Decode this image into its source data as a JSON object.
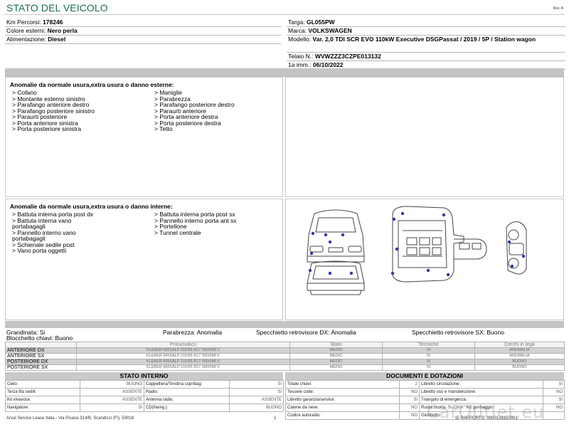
{
  "header": {
    "title": "STATO DEL VEICOLO",
    "rev": "Rev. A"
  },
  "info_left": [
    {
      "label": "Km Percorsi:",
      "value": "178246"
    },
    {
      "label": "Colore esterni:",
      "value": "Nero perla"
    },
    {
      "label": "Alimentazione:",
      "value": "Diesel"
    }
  ],
  "info_right": {
    "targa_label": "Targa:",
    "targa": "GL055PW",
    "marca_label": "Marca:",
    "marca": "VOLKSWAGEN",
    "modello_label": "Modello:",
    "modello": "Var. 2,0 TDI SCR EVO 110kW Executive DSGPassat / 2019 / 5P / Station wagon",
    "telaio_label": "Telaio N.:",
    "telaio": "WVWZZZ3CZPE013132",
    "imm_label": "1a imm.:",
    "imm": "06/10/2022"
  },
  "external_damage": {
    "title": "Anomalie da normale usura,extra usura o danno esterne:",
    "col1": [
      "> Cofano",
      "> Montante esterno sinistro",
      "> Parafango anteriore destro",
      "> Parafango posteriore sinistro",
      "> Paraurti posteriore",
      "> Porta anteriore sinistra",
      "> Porta posteriore sinistra"
    ],
    "col2": [
      "> Maniglie",
      "> Parabrezza",
      "> Parafango posteriore destro",
      "> Paraurti anteriore",
      "> Porta anteriore destra",
      "> Porta posteriore destra",
      "> Tetto"
    ]
  },
  "internal_damage": {
    "title": "Anomalie da normale usura,extra usura o danno interne:",
    "col1": [
      "> Battuta interna porta post dx",
      "> Battuta interna vano",
      "portabagagli",
      "> Pannello interno vano",
      "portabagagli",
      "> Schienale sedile post",
      "> Vano porta oggetti"
    ],
    "col2": [
      "> Battuta interna porta post sx",
      "> Pannello interno porta ant sx",
      "> Portellone",
      "> Tunnel centrale"
    ]
  },
  "status_line": {
    "grandinata": "Grandinata: Si",
    "chiavi": "Blocchetto chiavi: Buono",
    "parabrezza": "Parabrezza: Anomalia",
    "specchio_dx": "Specchietto retrovisore DX: Anomalia",
    "specchio_sx": "Specchietto retrovisore SX: Buono"
  },
  "tyres": {
    "headers": [
      "",
      "Pneumatico",
      "Stato",
      "Termiche",
      "Cerchi in lega"
    ],
    "rows": [
      {
        "pos": "ANTERIORE DX",
        "tyre": "KLEBER KRISALP 215/55 R17 000/098 V",
        "stato": "MEDIO",
        "termiche": "SI",
        "cerchi": "ANOMALIA"
      },
      {
        "pos": "ANTERIORE SX",
        "tyre": "KLEBER KRISALP 215/55 R17 000/098 V",
        "stato": "MEDIO",
        "termiche": "SI",
        "cerchi": "ANOMALIA"
      },
      {
        "pos": "POSTERIORE DX",
        "tyre": "KLEBER KRISALP 215/55 R17 000/098 V",
        "stato": "MEDIO",
        "termiche": "SI",
        "cerchi": "BUONO"
      },
      {
        "pos": "POSTERIORE SX",
        "tyre": "KLEBER KRISALP 215/55 R17 000/098 V",
        "stato": "MEDIO",
        "termiche": "SI",
        "cerchi": "BUONO"
      }
    ]
  },
  "stato_interno": {
    "title": "STATO INTERNO",
    "rows": [
      [
        "Cielo:",
        "BUONO",
        "Cappelliera/Tendina copribag:",
        "SI"
      ],
      [
        "Terza fila sedili:",
        "ASSENTE",
        "Radio:",
        "SI"
      ],
      [
        "Kit vivavoce:",
        "ASSENTE",
        "Antenna radio:",
        "ASSENTE"
      ],
      [
        "Navigatore:",
        "SI",
        "CD(Navig.):",
        "BUONO"
      ]
    ]
  },
  "documenti": {
    "title": "DOCUMENTI E DOTAZIONI",
    "rows": [
      [
        "Totale chiavi:",
        "2",
        "Libretto circolazione:",
        "SI"
      ],
      [
        "Tessere code:",
        "NO",
        "Libretto uso e manutenzione:",
        "NO"
      ],
      [
        "Libretto garanzia/service:",
        "SI",
        "Triangolo di emergenza:",
        "SI"
      ],
      [
        "Catene da neve:",
        "NO",
        "Ruota scorta:",
        "SUONA",
        "Kit gonfiaggio:",
        "NO"
      ],
      [
        "Codice autoradio:",
        "NO",
        "Giubbotto:",
        ""
      ]
    ]
  },
  "footer": {
    "company": "Arval Service Lease Italia - Via Pisana 314/B, Scandicci (FI), 50018",
    "page": "1",
    "doc_id": "ID RAPPORTO: 0000128150001",
    "watermark": "CarOutlet.eu"
  },
  "colors": {
    "title": "#18724a",
    "damage_dot": "#2a3aa6",
    "band": "#c4c4c4"
  }
}
